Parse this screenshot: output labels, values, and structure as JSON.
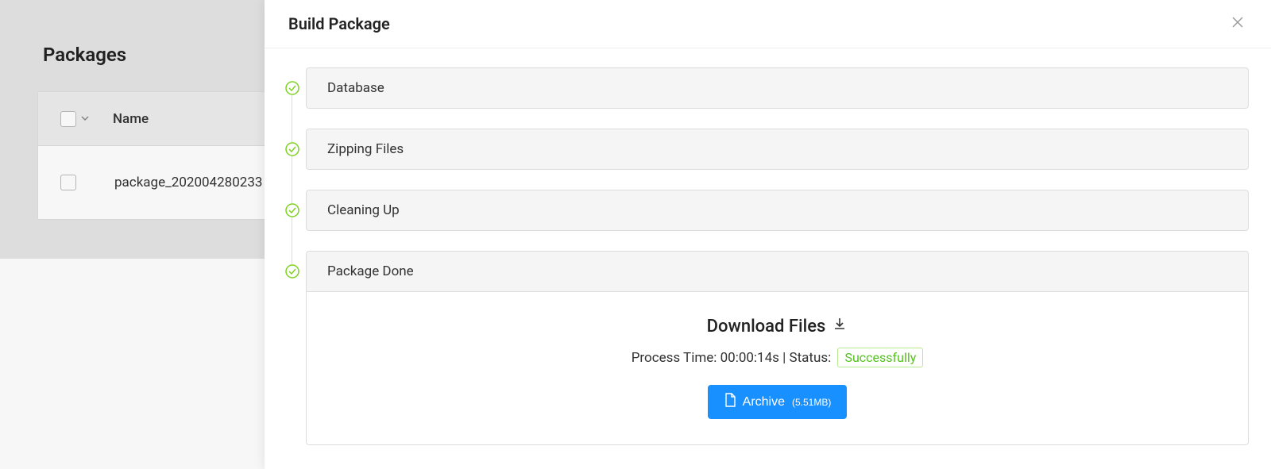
{
  "background": {
    "title": "Packages",
    "columns": {
      "name": "Name"
    },
    "rows": [
      {
        "name": "package_202004280233"
      }
    ]
  },
  "drawer": {
    "title": "Build Package",
    "steps": [
      {
        "label": "Database"
      },
      {
        "label": "Zipping Files"
      },
      {
        "label": "Cleaning Up"
      },
      {
        "label": "Package Done"
      }
    ],
    "download": {
      "title": "Download Files",
      "process_label": "Process Time:",
      "process_time": "00:00:14s",
      "status_label": "Status:",
      "status_value": "Successfully",
      "archive_label": "Archive",
      "archive_size": "(5.51MB)"
    }
  },
  "icons": {
    "close": "close-icon",
    "check": "check-circle-icon",
    "download": "download-icon",
    "file": "file-icon",
    "chevron": "chevron-down-icon"
  }
}
